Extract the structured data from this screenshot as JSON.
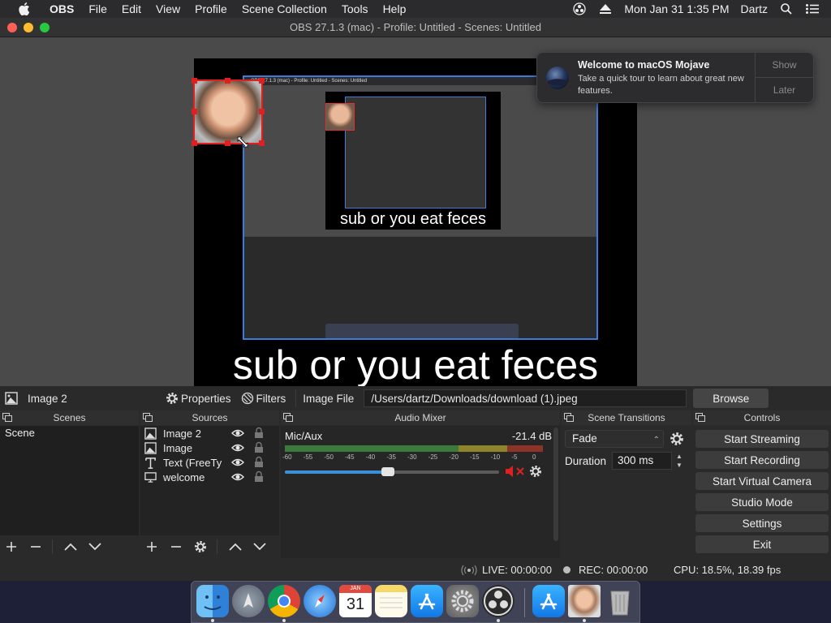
{
  "menubar": {
    "app_name": "OBS",
    "items": [
      "File",
      "Edit",
      "View",
      "Profile",
      "Scene Collection",
      "Tools",
      "Help"
    ],
    "clock": "Mon Jan 31  1:35 PM",
    "user": "Dartz"
  },
  "window": {
    "title": "OBS 27.1.3 (mac) - Profile: Untitled - Scenes: Untitled"
  },
  "preview": {
    "caption": "sub or you eat feces",
    "nested_caption": "sub or you eat feces",
    "nested_title": "OBS 27.1.3 (mac) - Profile: Untitled - Scenes: Untitled"
  },
  "notification": {
    "title": "Welcome to macOS Mojave",
    "message": "Take a quick tour to learn about great new features.",
    "show_label": "Show",
    "later_label": "Later"
  },
  "source_toolbar": {
    "selected_source": "Image 2",
    "properties_label": "Properties",
    "filters_label": "Filters",
    "image_file_label": "Image File",
    "path_value": "/Users/dartz/Downloads/download (1).jpeg",
    "browse_label": "Browse"
  },
  "scenes": {
    "title": "Scenes",
    "items": [
      "Scene"
    ]
  },
  "sources": {
    "title": "Sources",
    "items": [
      {
        "name": "Image 2",
        "icon": "image-icon"
      },
      {
        "name": "Image",
        "icon": "image-icon"
      },
      {
        "name": "Text (FreeTy",
        "icon": "text-icon"
      },
      {
        "name": "welcome",
        "icon": "display-icon"
      }
    ]
  },
  "audio_mixer": {
    "title": "Audio Mixer",
    "channel_name": "Mic/Aux",
    "level_db": "-21.4 dB",
    "scale": [
      "-60",
      "-55",
      "-50",
      "-45",
      "-40",
      "-35",
      "-30",
      "-25",
      "-20",
      "-15",
      "-10",
      "-5",
      "0"
    ],
    "volume_fraction": 0.48,
    "muted": true
  },
  "scene_transitions": {
    "title": "Scene Transitions",
    "transition": "Fade",
    "duration_label": "Duration",
    "duration_value": "300 ms"
  },
  "controls": {
    "title": "Controls",
    "buttons": [
      "Start Streaming",
      "Start Recording",
      "Start Virtual Camera",
      "Studio Mode",
      "Settings",
      "Exit"
    ]
  },
  "status": {
    "live": "LIVE: 00:00:00",
    "rec": "REC: 00:00:00",
    "cpu": "CPU: 18.5%, 18.39 fps"
  },
  "dock_apps": [
    "finder-icon",
    "launchpad-icon",
    "chrome-icon",
    "safari-icon",
    "calendar-icon",
    "notes-icon",
    "app-store-icon",
    "system-preferences-icon",
    "obs-icon",
    "app-store-downloads-icon",
    "image-preview-icon",
    "trash-icon"
  ],
  "calendar_icon": {
    "month": "JAN",
    "day": "31"
  },
  "colors": {
    "accent_blue": "#3d8fd9",
    "selection_red": "#e02020",
    "meter_green": "#3fae3f",
    "meter_yellow": "#c8b52c",
    "meter_red": "#c83a2c"
  }
}
